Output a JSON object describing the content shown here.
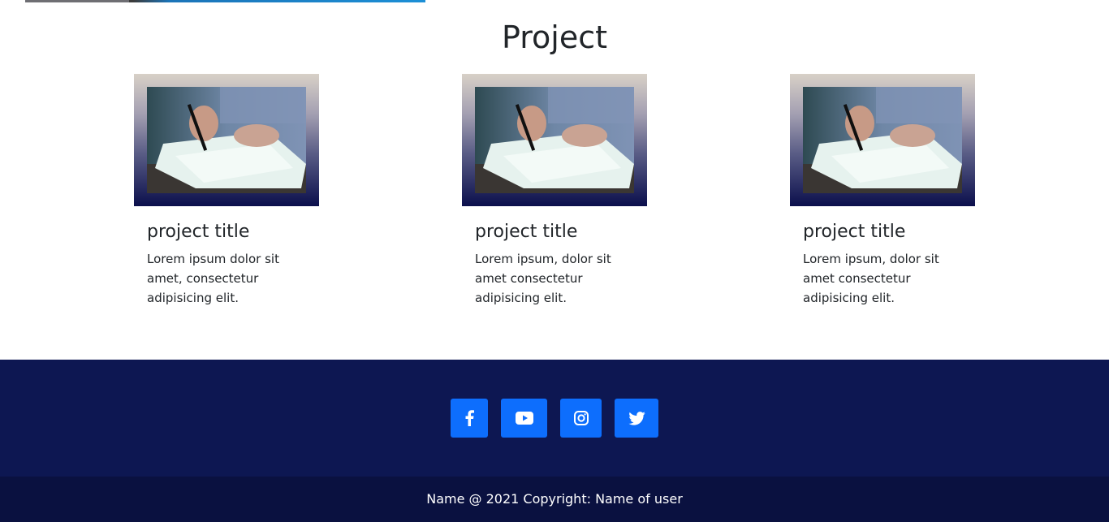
{
  "section": {
    "title": "Project"
  },
  "projects": [
    {
      "title": "project title",
      "text": "Lorem ipsum dolor sit amet, consectetur adipisicing elit."
    },
    {
      "title": "project title",
      "text": "Lorem ipsum, dolor sit amet consectetur adipisicing elit."
    },
    {
      "title": "project title",
      "text": "Lorem ipsum, dolor sit amet consectetur adipisicing elit."
    }
  ],
  "social": [
    {
      "icon": "facebook-icon"
    },
    {
      "icon": "youtube-icon"
    },
    {
      "icon": "instagram-icon"
    },
    {
      "icon": "twitter-icon"
    }
  ],
  "footer": {
    "copyright": "Name @ 2021 Copyright: Name of user"
  },
  "colors": {
    "footer_bg": "#0d1752",
    "copyright_bg": "#0a1140",
    "social_button": "#0d6efd"
  }
}
